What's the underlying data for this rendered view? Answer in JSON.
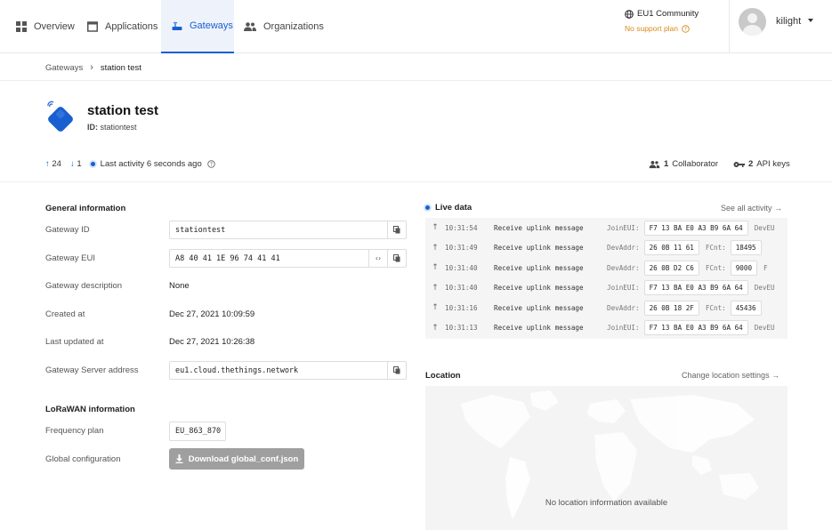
{
  "nav": {
    "items": [
      {
        "label": "Overview",
        "icon": "grid-icon"
      },
      {
        "label": "Applications",
        "icon": "window-icon"
      },
      {
        "label": "Gateways",
        "icon": "gateway-icon",
        "active": true
      },
      {
        "label": "Organizations",
        "icon": "people-icon"
      }
    ],
    "community": "EU1 Community",
    "support_plan": "No support plan",
    "username": "kilight"
  },
  "breadcrumb": {
    "parent": "Gateways",
    "current": "station test"
  },
  "gateway": {
    "title": "station test",
    "id_label": "ID:",
    "id": "stationtest",
    "uplink_count": "24",
    "downlink_count": "1",
    "last_activity": "Last activity 6 seconds ago",
    "collaborators_count": "1",
    "collaborators_label": "Collaborator",
    "api_keys_count": "2",
    "api_keys_label": "API keys"
  },
  "general": {
    "title": "General information",
    "gateway_id_label": "Gateway ID",
    "gateway_id": "stationtest",
    "gateway_eui_label": "Gateway EUI",
    "gateway_eui": "A8 40 41 1E 96 74 41 41",
    "description_label": "Gateway description",
    "description": "None",
    "created_label": "Created at",
    "created": "Dec 27, 2021 10:09:59",
    "updated_label": "Last updated at",
    "updated": "Dec 27, 2021 10:26:38",
    "server_label": "Gateway Server address",
    "server": "eu1.cloud.thethings.network"
  },
  "lorawan": {
    "title": "LoRaWAN information",
    "freq_label": "Frequency plan",
    "freq": "EU_863_870",
    "global_label": "Global configuration",
    "download_label": "Download global_conf.json"
  },
  "live": {
    "title": "Live data",
    "see_all": "See all activity →",
    "events": [
      {
        "time": "10:31:54",
        "msg": "Receive uplink message",
        "k1": "JoinEUI:",
        "v1": "F7 13 BA E0 A3 B9 6A 64",
        "k2": "DevEU"
      },
      {
        "time": "10:31:49",
        "msg": "Receive uplink message",
        "k1": "DevAddr:",
        "v1": "26 0B 11 61",
        "k2": "FCnt:",
        "v2": "18495"
      },
      {
        "time": "10:31:40",
        "msg": "Receive uplink message",
        "k1": "DevAddr:",
        "v1": "26 0B D2 C6",
        "k2": "FCnt:",
        "v2": "9000",
        "k3": "F"
      },
      {
        "time": "10:31:40",
        "msg": "Receive uplink message",
        "k1": "JoinEUI:",
        "v1": "F7 13 BA E0 A3 B9 6A 64",
        "k2": "DevEU"
      },
      {
        "time": "10:31:16",
        "msg": "Receive uplink message",
        "k1": "DevAddr:",
        "v1": "26 0B 18 2F",
        "k2": "FCnt:",
        "v2": "45436"
      },
      {
        "time": "10:31:13",
        "msg": "Receive uplink message",
        "k1": "JoinEUI:",
        "v1": "F7 13 BA E0 A3 B9 6A 64",
        "k2": "DevEU"
      }
    ]
  },
  "location": {
    "title": "Location",
    "change_link": "Change location settings →",
    "empty_msg": "No location information available"
  },
  "colors": {
    "accent": "#1a5fd1",
    "warning": "#d98a1b"
  }
}
